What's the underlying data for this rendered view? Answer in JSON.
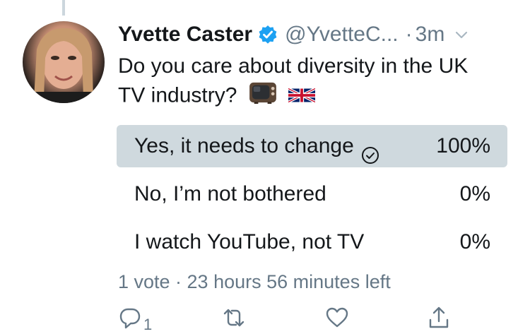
{
  "tweet": {
    "author_name": "Yvette Caster",
    "handle": "@YvetteC...",
    "separator": "·",
    "time": "3m",
    "text": "Do you care about diversity in the UK TV industry?"
  },
  "poll": {
    "options": [
      {
        "label": "Yes, it needs to change",
        "percent": "100%",
        "fraction": 1.0,
        "selected": true
      },
      {
        "label": "No, I’m not bothered",
        "percent": "0%",
        "fraction": 0,
        "selected": false
      },
      {
        "label": "I watch YouTube, not TV",
        "percent": "0%",
        "fraction": 0,
        "selected": false
      }
    ],
    "summary": "1 vote · 23 hours 56 minutes left"
  },
  "actions": {
    "reply_count": "1",
    "icons": [
      "reply-icon",
      "retweet-icon",
      "like-icon",
      "share-icon"
    ]
  },
  "colors": {
    "accent": "#1da1f2",
    "muted": "#657786",
    "poll_fill": "#cfd9de"
  }
}
